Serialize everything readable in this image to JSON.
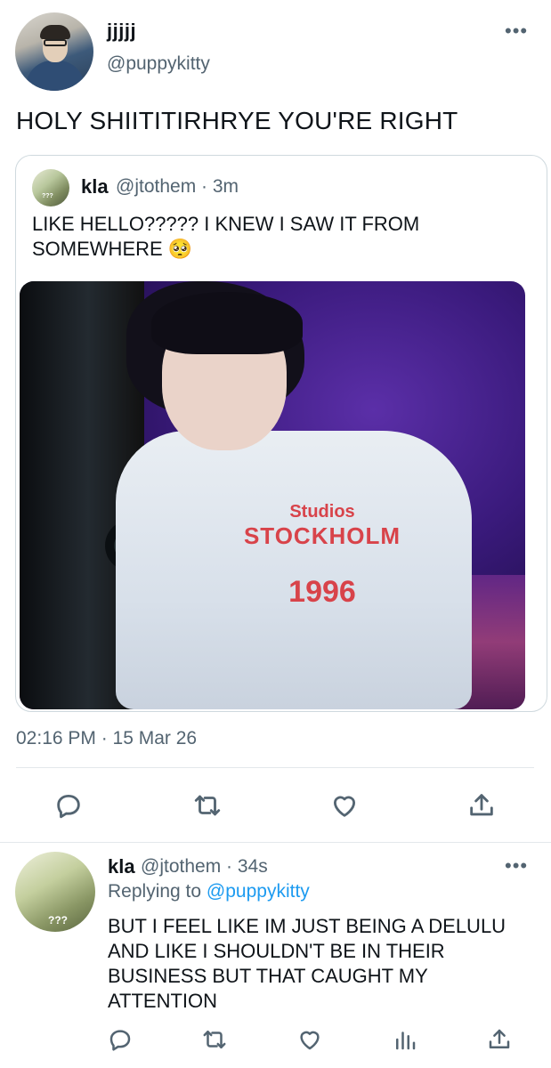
{
  "main_tweet": {
    "display_name": "jjjjj",
    "handle": "@puppykitty",
    "more_icon": "more-dots-icon",
    "text": "HOLY SHIITITIRHRYE YOU'RE RIGHT",
    "timestamp": "02:16 PM · 15 Mar 26"
  },
  "quoted_tweet": {
    "display_name": "kla",
    "handle_time": "@jtothem · 3m",
    "text": "LIKE HELLO????? I KNEW I SAW IT FROM SOMEWHERE 🥺",
    "avatar_caption": "???",
    "photo": {
      "shirt_line1": "Studios",
      "shirt_line2": "STOCKHOLM",
      "shirt_line3": "1996"
    }
  },
  "actions": {
    "reply_icon": "reply-icon",
    "retweet_icon": "retweet-icon",
    "like_icon": "heart-icon",
    "share_icon": "share-icon"
  },
  "reply_tweet": {
    "display_name": "kla",
    "handle_time": "@jtothem · 34s",
    "replying_prefix": "Replying to",
    "replying_mention": "@puppykitty",
    "avatar_caption": "???",
    "text": "BUT I FEEL LIKE IM JUST BEING A DELULU AND LIKE I SHOULDN'T BE IN THEIR BUSINESS BUT THAT CAUGHT MY ATTENTION",
    "actions": [
      "reply-icon",
      "retweet-icon",
      "heart-icon",
      "views-icon",
      "share-icon"
    ]
  },
  "colors": {
    "text": "#0f1419",
    "secondary": "#536471",
    "link": "#1d9bf0",
    "border": "#cfd9de"
  }
}
